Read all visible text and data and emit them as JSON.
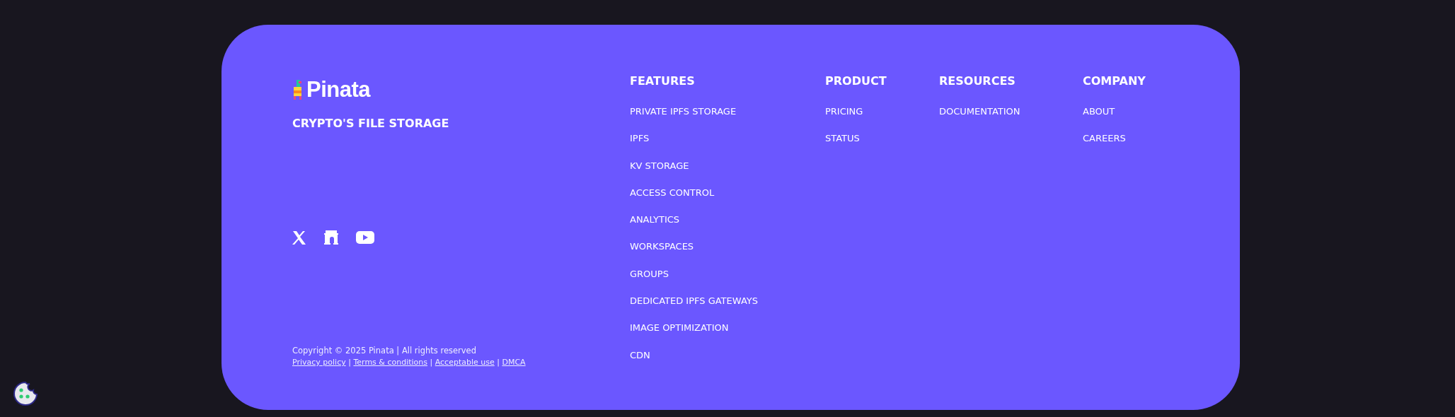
{
  "brand": {
    "name": "Pinata",
    "tagline": "CRYPTO'S FILE STORAGE"
  },
  "social": [
    {
      "kind": "x"
    },
    {
      "kind": "farcaster"
    },
    {
      "kind": "youtube"
    }
  ],
  "copyright": "Copyright © 2025 Pinata | All rights reserved",
  "legal_separator": "|",
  "legal_links": [
    "Privacy policy",
    "Terms & conditions",
    "Acceptable use",
    "DMCA"
  ],
  "columns": [
    {
      "heading": "FEATURES",
      "links": [
        "PRIVATE IPFS STORAGE",
        "IPFS",
        "KV STORAGE",
        "ACCESS CONTROL",
        "ANALYTICS",
        "WORKSPACES",
        "GROUPS",
        "DEDICATED IPFS GATEWAYS",
        "IMAGE OPTIMIZATION",
        "CDN"
      ]
    },
    {
      "heading": "PRODUCT",
      "links": [
        "PRICING",
        "STATUS"
      ]
    },
    {
      "heading": "RESOURCES",
      "links": [
        "DOCUMENTATION"
      ]
    },
    {
      "heading": "COMPANY",
      "links": [
        "ABOUT",
        "CAREERS"
      ]
    }
  ]
}
